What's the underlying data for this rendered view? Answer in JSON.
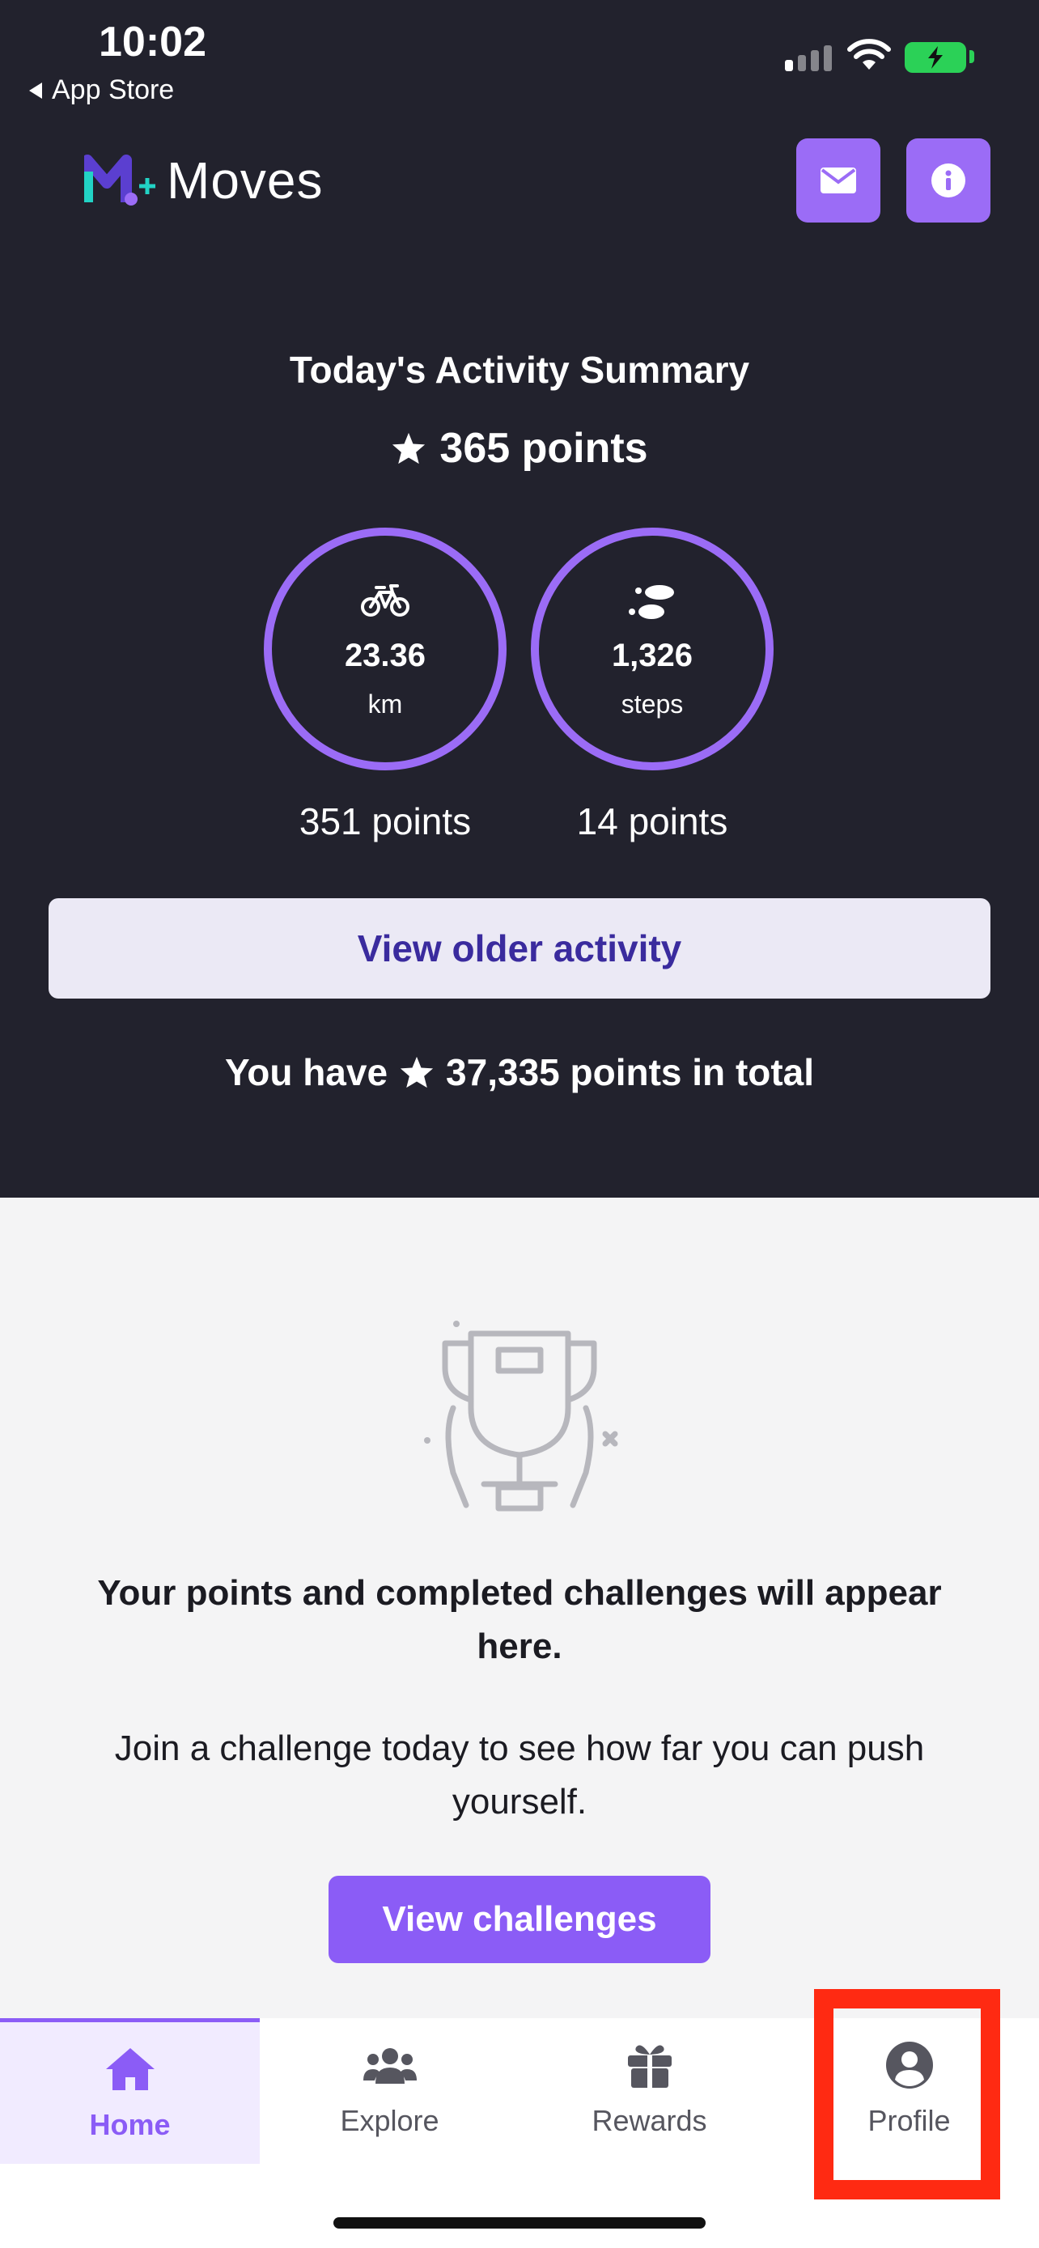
{
  "status_bar": {
    "time": "10:02",
    "back_app": "App Store",
    "battery_color": "#2bd157"
  },
  "header": {
    "logo_text": "Moves",
    "logo_mark": "M+",
    "message_button_icon": "envelope-icon",
    "info_button_icon": "info-icon",
    "accent_color": "#9b6cf6"
  },
  "summary": {
    "title": "Today's Activity Summary",
    "points": "365 points",
    "rings": [
      {
        "icon": "bicycle-icon",
        "value": "23.36",
        "unit": "km",
        "points": "351 points"
      },
      {
        "icon": "footsteps-icon",
        "value": "1,326",
        "unit": "steps",
        "points": "14 points"
      }
    ],
    "older_button": "View older activity",
    "total_prefix": "You have",
    "total_suffix": "37,335 points in total"
  },
  "empty_state": {
    "illustration": "trophy-icon",
    "title": "Your points and completed challenges will appear here.",
    "subtitle": "Join a challenge today to see how far you can push yourself.",
    "button": "View challenges"
  },
  "tabbar": {
    "tabs": [
      {
        "label": "Home",
        "icon": "home-icon",
        "active": true
      },
      {
        "label": "Explore",
        "icon": "people-icon",
        "active": false
      },
      {
        "label": "Rewards",
        "icon": "gift-icon",
        "active": false
      },
      {
        "label": "Profile",
        "icon": "user-circle-icon",
        "active": false
      }
    ],
    "highlight_color": "#ff2a12"
  }
}
